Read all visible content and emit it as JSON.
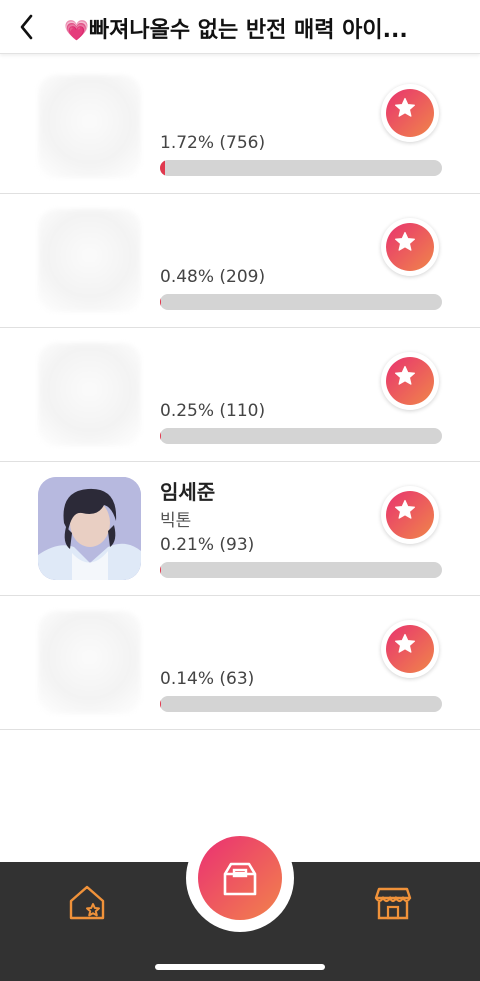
{
  "header": {
    "title_emoji": "💗",
    "title": "빠져나올수 없는 반전 매력 아이..."
  },
  "rows": [
    {
      "name": "",
      "group": "",
      "percent_text": "1.72% (756)",
      "vote_share": 1.72,
      "vote_count": 756,
      "avatar": "blurred"
    },
    {
      "name": "",
      "group": "",
      "percent_text": "0.48% (209)",
      "vote_share": 0.48,
      "vote_count": 209,
      "avatar": "blurred"
    },
    {
      "name": "",
      "group": "",
      "percent_text": "0.25% (110)",
      "vote_share": 0.25,
      "vote_count": 110,
      "avatar": "blurred"
    },
    {
      "name": "임세준",
      "group": "빅톤",
      "percent_text": "0.21% (93)",
      "vote_share": 0.21,
      "vote_count": 93,
      "avatar": "photo"
    },
    {
      "name": "",
      "group": "",
      "percent_text": "0.14% (63)",
      "vote_share": 0.14,
      "vote_count": 63,
      "avatar": "blurred"
    }
  ],
  "icons": {
    "back": "chevron-left-icon",
    "vote": "star-icon",
    "home": "home-star-icon",
    "center": "ballot-box-icon",
    "store": "store-icon"
  },
  "colors": {
    "accent_start": "#e8336f",
    "accent_end": "#f0864a",
    "bar_fill": "#e0384e",
    "bar_track": "#d4d4d4",
    "nav_bg": "#323232",
    "nav_icon": "#f0923a"
  }
}
